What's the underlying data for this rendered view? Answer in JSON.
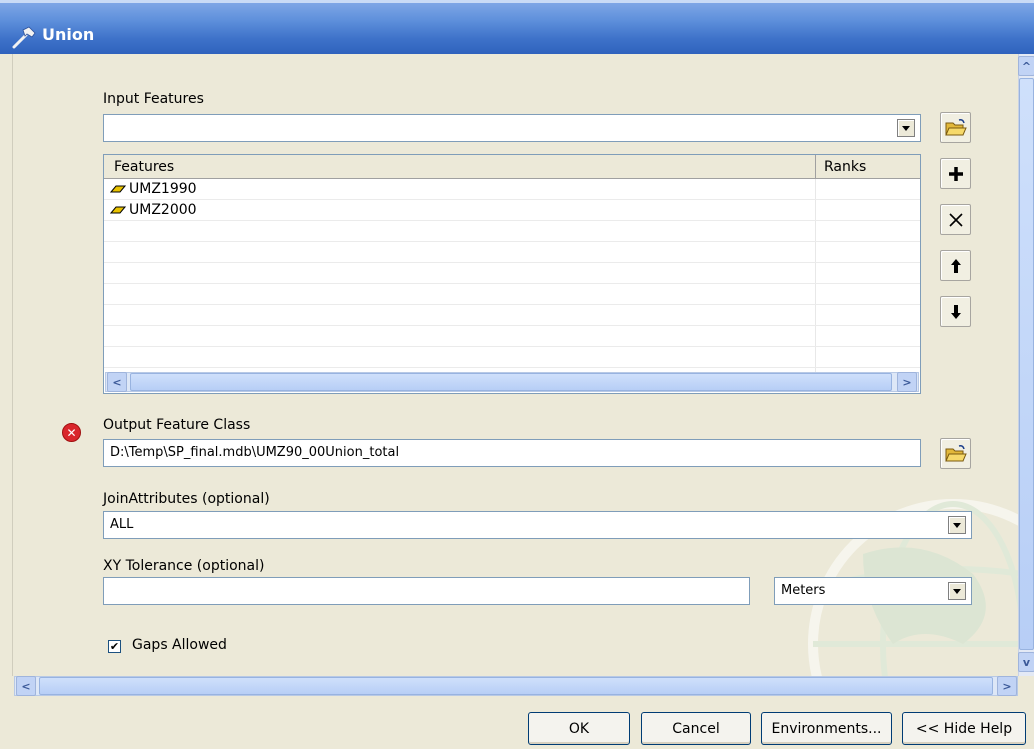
{
  "window": {
    "title": "Union",
    "icon": "hammer-icon"
  },
  "input_features": {
    "label": "Input Features",
    "value": "",
    "browse_icon": "open-folder-icon",
    "table": {
      "columns": [
        "Features",
        "Ranks"
      ],
      "rows": [
        {
          "feature": "UMZ1990",
          "rank": "",
          "icon": "polygon-layer-icon"
        },
        {
          "feature": "UMZ2000",
          "rank": "",
          "icon": "polygon-layer-icon"
        }
      ]
    },
    "side_buttons": [
      {
        "name": "add-icon",
        "glyph": "+"
      },
      {
        "name": "remove-icon",
        "glyph": "×"
      },
      {
        "name": "move-up-icon",
        "glyph": "↑"
      },
      {
        "name": "move-down-icon",
        "glyph": "↓"
      }
    ]
  },
  "output": {
    "label": "Output Feature Class",
    "value": "D:\\Temp\\SP_final.mdb\\UMZ90_00Union_total",
    "error_icon": "error-icon"
  },
  "join_attributes": {
    "label": "JoinAttributes (optional)",
    "value": "ALL"
  },
  "xy_tolerance": {
    "label": "XY Tolerance (optional)",
    "value": "",
    "unit": "Meters"
  },
  "gaps": {
    "label": "Gaps Allowed",
    "checked": true
  },
  "buttons": {
    "ok": "OK",
    "cancel": "Cancel",
    "environments": "Environments...",
    "hide_help": "<< Hide Help"
  },
  "colors": {
    "title_bar": "#3e72c9",
    "accent_yellow": "#e8c200",
    "error_red": "#d9262c"
  }
}
